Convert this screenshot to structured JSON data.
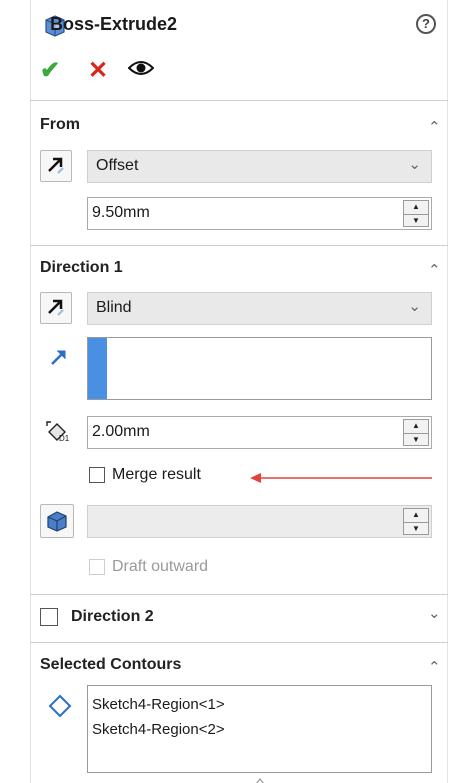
{
  "header": {
    "title": "Boss-Extrude2",
    "help_icon": "help-icon",
    "help_glyph": "?"
  },
  "actions": {
    "ok_glyph": "✔",
    "cancel_glyph": "✕"
  },
  "sections": {
    "from": {
      "title": "From",
      "end_condition": "Offset",
      "offset_value": "9.50mm"
    },
    "direction1": {
      "title": "Direction 1",
      "end_condition": "Blind",
      "depth_value": "2.00mm",
      "merge_result_label": "Merge result",
      "merge_result_checked": false,
      "draft_outward_label": "Draft outward",
      "draft_outward_checked": false,
      "draft_angle_value": ""
    },
    "direction2": {
      "title": "Direction 2",
      "checked": false
    },
    "selected_contours": {
      "title": "Selected Contours",
      "items": [
        "Sketch4-Region<1>",
        "Sketch4-Region<2>"
      ]
    }
  },
  "glyphs": {
    "chevron_up": "⌃",
    "chevron_down": "⌄",
    "dropdown": "⌄",
    "spin_up": "▲",
    "spin_down": "▼"
  },
  "colors": {
    "ok": "#3aa83a",
    "cancel": "#d9261c",
    "annotation_arrow": "#e0443a",
    "direction_bar": "#4a90e2",
    "icon_blue": "#2a6fc9"
  }
}
